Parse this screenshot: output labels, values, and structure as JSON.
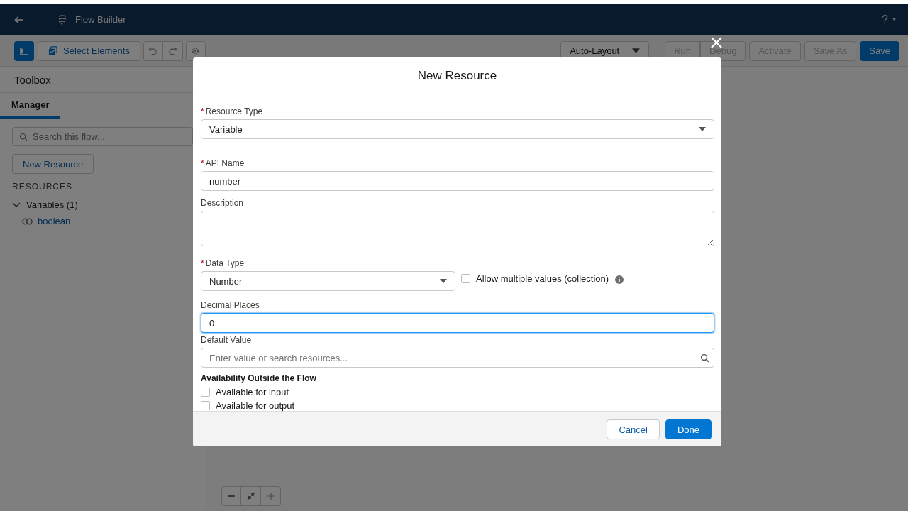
{
  "header": {
    "title": "Flow Builder",
    "help": "?"
  },
  "toolbar": {
    "select_elements": "Select Elements",
    "layout": "Auto-Layout",
    "buttons": [
      {
        "label": "Run",
        "kind": "neutral",
        "disabled": true
      },
      {
        "label": "Debug",
        "kind": "neutral",
        "disabled": true
      },
      {
        "label": "Activate",
        "kind": "neutral",
        "disabled": true
      },
      {
        "label": "Save As",
        "kind": "neutral",
        "disabled": true
      },
      {
        "label": "Save",
        "kind": "brand",
        "disabled": false
      }
    ]
  },
  "sidebar": {
    "title": "Toolbox",
    "tabs": [
      {
        "label": "Manager",
        "selected": true
      }
    ],
    "search": {
      "placeholder": "Search this flow..."
    },
    "new_resource": "New Resource",
    "section": "RESOURCES",
    "tree": [
      {
        "label": "Variables (1)",
        "expanded": true,
        "children": [
          {
            "label": "boolean"
          }
        ]
      }
    ]
  },
  "modal": {
    "title": "New Resource",
    "required_mark": "*",
    "resource_type": {
      "label": "Resource Type",
      "required": true,
      "value": "Variable"
    },
    "api_name": {
      "label": "API Name",
      "required": true,
      "value": "number"
    },
    "description": {
      "label": "Description"
    },
    "data_type": {
      "label": "Data Type",
      "required": true,
      "value": "Number"
    },
    "collection": {
      "label": "Allow multiple values (collection)",
      "checked": false
    },
    "decimal_places": {
      "label": "Decimal Places",
      "value": "0",
      "focused": true
    },
    "default_value": {
      "label": "Default Value",
      "placeholder": "Enter value or search resources..."
    },
    "availability": {
      "title": "Availability Outside the Flow",
      "options": [
        {
          "label": "Available for input",
          "checked": false
        },
        {
          "label": "Available for output",
          "checked": false
        }
      ]
    },
    "cancel": "Cancel",
    "done": "Done"
  }
}
